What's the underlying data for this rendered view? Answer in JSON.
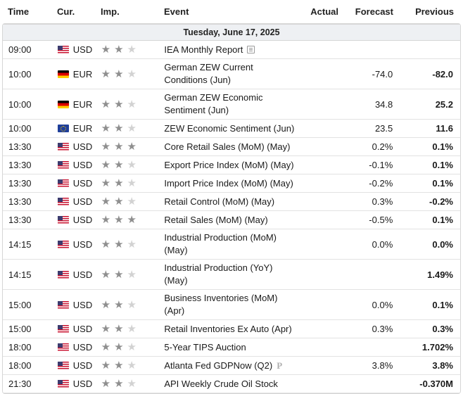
{
  "header": {
    "time": "Time",
    "currency": "Cur.",
    "importance": "Imp.",
    "event": "Event",
    "actual": "Actual",
    "forecast": "Forecast",
    "previous": "Previous"
  },
  "day_label": "Tuesday, June 17, 2025",
  "rows": [
    {
      "time": "09:00",
      "currency": "USD",
      "flag": "us-flag-icon",
      "stars": 2,
      "event": "IEA Monthly Report",
      "icon": "document-icon",
      "actual": "",
      "forecast": "",
      "previous": ""
    },
    {
      "time": "10:00",
      "currency": "EUR",
      "flag": "germany-flag-icon",
      "stars": 2,
      "event": "German ZEW Current Conditions (Jun)",
      "actual": "",
      "forecast": "-74.0",
      "previous": "-82.0"
    },
    {
      "time": "10:00",
      "currency": "EUR",
      "flag": "germany-flag-icon",
      "stars": 2,
      "event": "German ZEW Economic Sentiment (Jun)",
      "actual": "",
      "forecast": "34.8",
      "previous": "25.2"
    },
    {
      "time": "10:00",
      "currency": "EUR",
      "flag": "eu-flag-icon",
      "stars": 2,
      "event": "ZEW Economic Sentiment (Jun)",
      "actual": "",
      "forecast": "23.5",
      "previous": "11.6"
    },
    {
      "time": "13:30",
      "currency": "USD",
      "flag": "us-flag-icon",
      "stars": 3,
      "event": "Core Retail Sales (MoM) (May)",
      "actual": "",
      "forecast": "0.2%",
      "previous": "0.1%"
    },
    {
      "time": "13:30",
      "currency": "USD",
      "flag": "us-flag-icon",
      "stars": 2,
      "event": "Export Price Index (MoM) (May)",
      "actual": "",
      "forecast": "-0.1%",
      "previous": "0.1%"
    },
    {
      "time": "13:30",
      "currency": "USD",
      "flag": "us-flag-icon",
      "stars": 2,
      "event": "Import Price Index (MoM) (May)",
      "actual": "",
      "forecast": "-0.2%",
      "previous": "0.1%"
    },
    {
      "time": "13:30",
      "currency": "USD",
      "flag": "us-flag-icon",
      "stars": 2,
      "event": "Retail Control (MoM) (May)",
      "actual": "",
      "forecast": "0.3%",
      "previous": "-0.2%"
    },
    {
      "time": "13:30",
      "currency": "USD",
      "flag": "us-flag-icon",
      "stars": 3,
      "event": "Retail Sales (MoM) (May)",
      "actual": "",
      "forecast": "-0.5%",
      "previous": "0.1%"
    },
    {
      "time": "14:15",
      "currency": "USD",
      "flag": "us-flag-icon",
      "stars": 2,
      "event": "Industrial Production (MoM) (May)",
      "actual": "",
      "forecast": "0.0%",
      "previous": "0.0%"
    },
    {
      "time": "14:15",
      "currency": "USD",
      "flag": "us-flag-icon",
      "stars": 2,
      "event": "Industrial Production (YoY) (May)",
      "actual": "",
      "forecast": "",
      "previous": "1.49%"
    },
    {
      "time": "15:00",
      "currency": "USD",
      "flag": "us-flag-icon",
      "stars": 2,
      "event": "Business Inventories (MoM) (Apr)",
      "actual": "",
      "forecast": "0.0%",
      "previous": "0.1%"
    },
    {
      "time": "15:00",
      "currency": "USD",
      "flag": "us-flag-icon",
      "stars": 2,
      "event": "Retail Inventories Ex Auto (Apr)",
      "actual": "",
      "forecast": "0.3%",
      "previous": "0.3%"
    },
    {
      "time": "18:00",
      "currency": "USD",
      "flag": "us-flag-icon",
      "stars": 2,
      "event": "5-Year TIPS Auction",
      "actual": "",
      "forecast": "",
      "previous": "1.702%"
    },
    {
      "time": "18:00",
      "currency": "USD",
      "flag": "us-flag-icon",
      "stars": 2,
      "event": "Atlanta Fed GDPNow (Q2)",
      "icon": "preliminary-icon",
      "icon_text": "P",
      "actual": "",
      "forecast": "3.8%",
      "previous": "3.8%"
    },
    {
      "time": "21:30",
      "currency": "USD",
      "flag": "us-flag-icon",
      "stars": 2,
      "event": "API Weekly Crude Oil Stock",
      "actual": "",
      "forecast": "",
      "previous": "-0.370M"
    }
  ]
}
